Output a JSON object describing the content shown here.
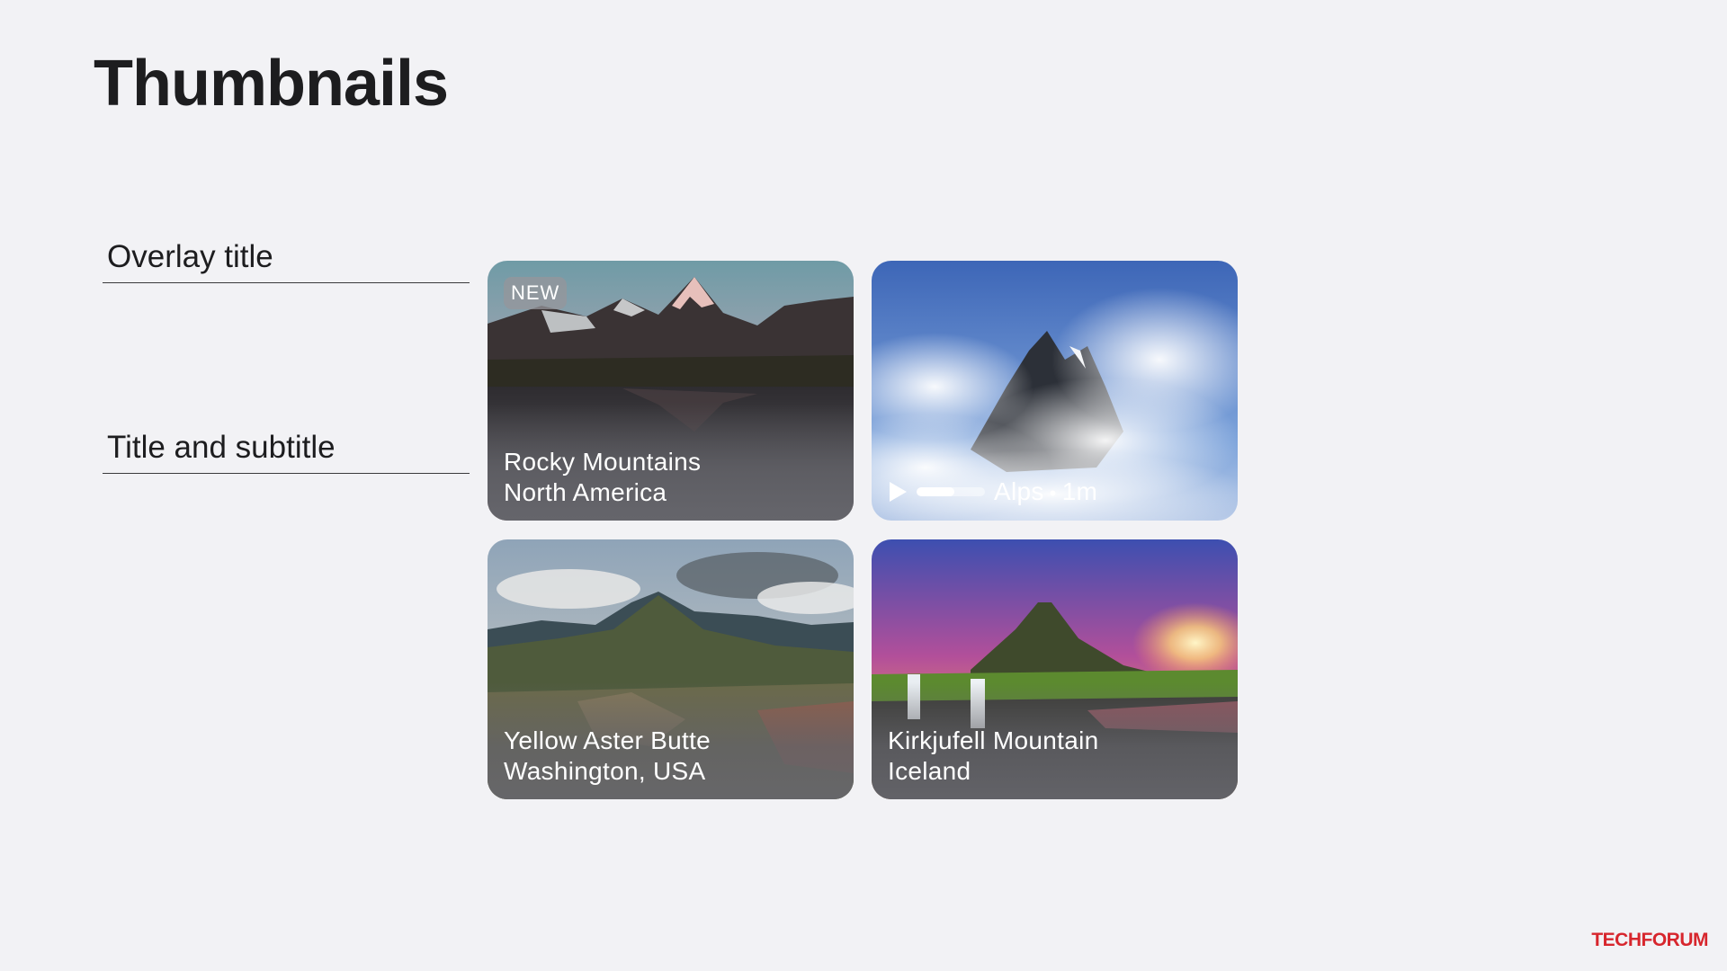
{
  "page": {
    "title": "Thumbnails"
  },
  "annotations": {
    "overlay_title": "Overlay title",
    "title_subtitle": "Title and subtitle"
  },
  "cards": [
    {
      "title": "Rocky Mountains",
      "subtitle": "North America",
      "badge": "NEW"
    },
    {
      "player": {
        "label": "Alps",
        "separator": "•",
        "duration": "1m",
        "progress": 0.55
      }
    },
    {
      "title": "Yellow Aster Butte",
      "subtitle": "Washington, USA"
    },
    {
      "title": "Kirkjufell Mountain",
      "subtitle": "Iceland"
    }
  ],
  "icons": {
    "play": "play-icon"
  },
  "brand": {
    "part1": "TECH",
    "part2": "FORUM",
    "color": "#d7262d"
  }
}
